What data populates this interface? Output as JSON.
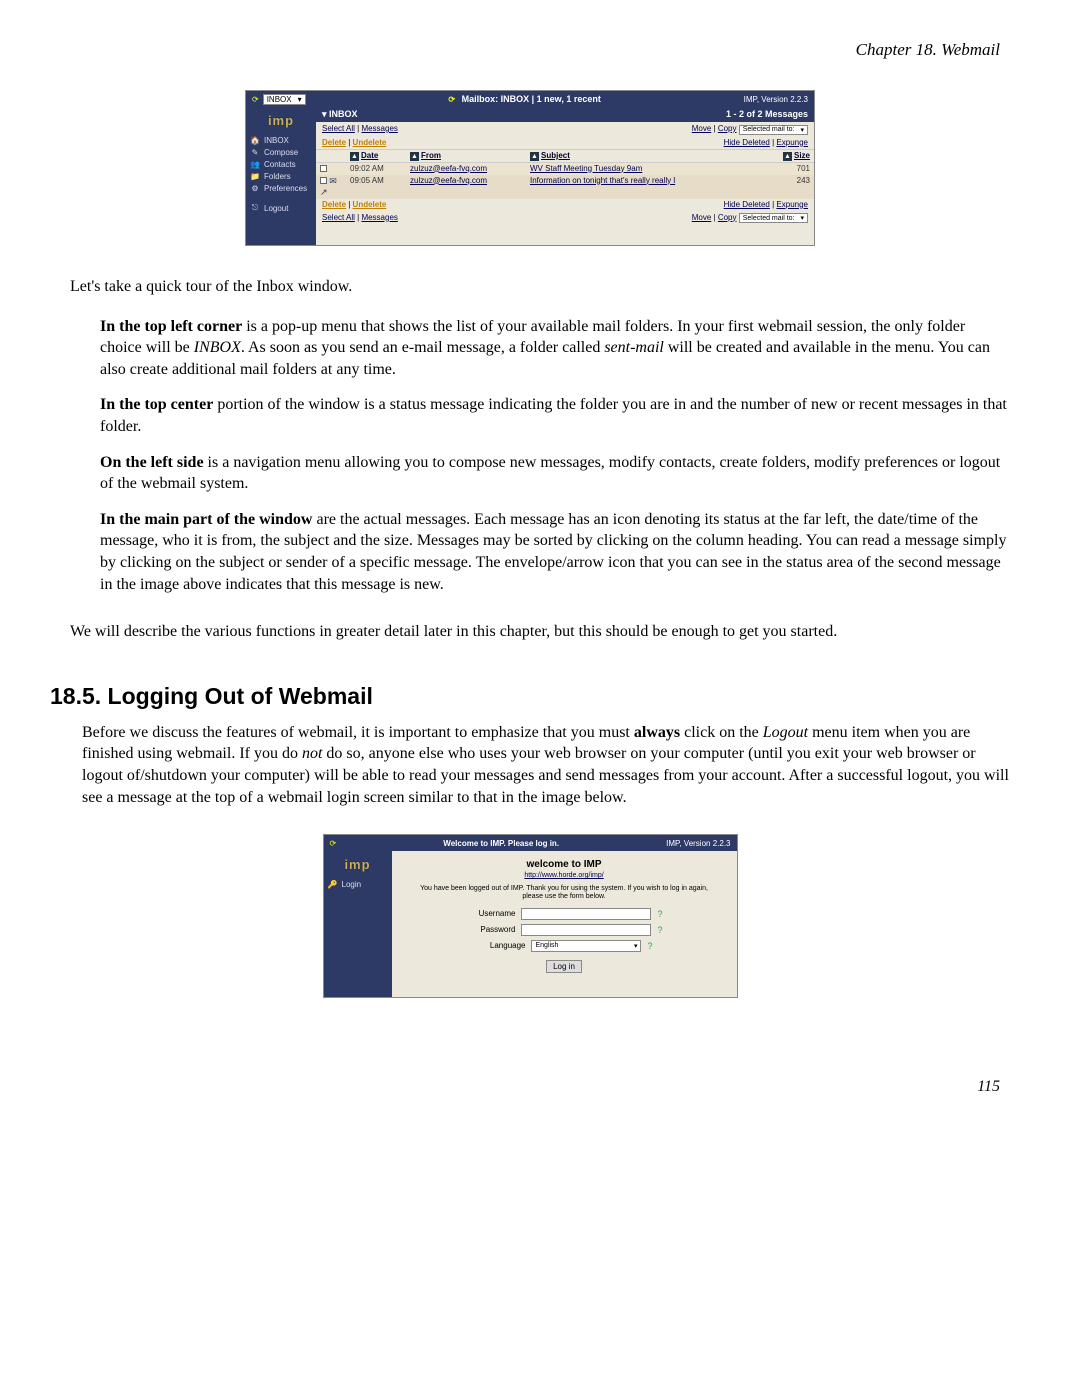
{
  "page": {
    "chapter_header": "Chapter 18. Webmail",
    "page_number": "115"
  },
  "screenshot1": {
    "topbar": {
      "folder_selected": "INBOX",
      "dropdown_arrow": "▾",
      "refresh_icon": "⟳",
      "status": "Mailbox: INBOX | 1 new, 1 recent",
      "version": "IMP, Version 2.2.3"
    },
    "sidebar": {
      "logo": "imp",
      "items": [
        {
          "icon": "🏠",
          "label": "INBOX"
        },
        {
          "icon": "✎",
          "label": "Compose"
        },
        {
          "icon": "👥",
          "label": "Contacts"
        },
        {
          "icon": "📁",
          "label": "Folders"
        },
        {
          "icon": "⚙",
          "label": "Preferences"
        }
      ],
      "logout": {
        "icon": "⎋",
        "label": "Logout"
      }
    },
    "main": {
      "inbox_label": "INBOX",
      "count_label": "1 - 2 of 2 Messages",
      "actions_top": {
        "left": {
          "a": "Select All",
          "sep": " | ",
          "b": "Messages"
        },
        "right": {
          "a": "Move",
          "sep": " | ",
          "b": "Copy",
          "select_text": "Selected mail to:",
          "arrow": "▾"
        }
      },
      "actions_mid": {
        "left": {
          "a": "Delete",
          "sep": " | ",
          "b": "Undelete"
        },
        "right": {
          "a": "Hide Deleted",
          "sep": " | ",
          "b": "Expunge"
        }
      },
      "headers": {
        "date": "Date",
        "from": "From",
        "subject": "Subject",
        "size": "Size",
        "arrow": "▲"
      },
      "rows": [
        {
          "icon": "",
          "date": "09:02 AM",
          "from": "zulzuz@eefa-fvq.com",
          "subject": "WV Staff Meeting Tuesday 9am",
          "size": "701"
        },
        {
          "icon": "✉↗",
          "date": "09:05 AM",
          "from": "zulzuz@eefa-fvq.com",
          "subject": "Information on tonight that's really really l",
          "size": "243"
        }
      ],
      "actions_bot_left": {
        "a": "Delete",
        "sep": " | ",
        "b": "Undelete"
      },
      "actions_bot_right": {
        "a": "Hide Deleted",
        "sep": " | ",
        "b": "Expunge"
      },
      "actions_bot2_left": {
        "a": "Select All",
        "sep": " | ",
        "b": "Messages"
      },
      "actions_bot2_right": {
        "a": "Move",
        "sep": " | ",
        "b": "Copy",
        "select_text": "Selected mail to:",
        "arrow": "▾"
      }
    }
  },
  "doc": {
    "intro": "Let's take a quick tour of the Inbox window.",
    "p1_bold": "In the top left corner",
    "p1_rest_a": " is a pop-up menu that shows the list of your available mail folders. In your first webmail session, the only folder choice will be ",
    "p1_em": "INBOX",
    "p1_rest_b": ". As soon as you send an e-mail message, a folder called ",
    "p1_em2": "sent-mail",
    "p1_rest_c": " will be created and available in the menu. You can also create additional mail folders at any time.",
    "p2_bold": "In the top center",
    "p2_rest": " portion of the window is a status message indicating the folder you are in and the number of new or recent messages in that folder.",
    "p3_bold": "On the left side",
    "p3_rest": " is a navigation menu allowing you to compose new messages, modify contacts, create folders, modify preferences or logout of the webmail system.",
    "p4_bold": "In the main part of the window",
    "p4_rest": " are the actual messages. Each message has an icon denoting its status at the far left, the date/time of the message, who it is from, the subject and the size. Messages may be sorted by clicking on the column heading. You can read a message simply by clicking on the subject or sender of a specific message. The envelope/arrow icon that you can see in the status area of the second message in the image above indicates that this message is new.",
    "transition": "We will describe the various functions in greater detail later in this chapter, but this should be enough to get you started."
  },
  "section": {
    "heading": "18.5. Logging Out of Webmail",
    "p_a": "Before we discuss the features of webmail, it is important to emphasize that you must ",
    "p_bold1": "always",
    "p_b": " click on the ",
    "p_em1": "Logout",
    "p_c": " menu item when you are finished using webmail. If you do ",
    "p_em2": "not",
    "p_d": " do so, anyone else who uses your web browser on your computer (until you exit your web browser or logout of/shutdown your computer) will be able to read your messages and send messages from your account. After a successful logout, you will see a message at the top of a webmail login screen similar to that in the image below."
  },
  "screenshot2": {
    "topbar": {
      "refresh": "⟳",
      "center": "Welcome to IMP. Please log in.",
      "version": "IMP, Version 2.2.3"
    },
    "sidebar": {
      "logo": "imp",
      "login": {
        "icon": "🔑",
        "label": "Login"
      }
    },
    "main": {
      "welcome": "welcome to IMP",
      "sublink": "http://www.horde.org/imp/",
      "msg": "You have been logged out of IMP. Thank you for using the system. If you wish to log in again, please use the form below.",
      "username_label": "Username",
      "password_label": "Password",
      "language_label": "Language",
      "language_value": "English",
      "language_arrow": "▾",
      "help_icon": "?",
      "login_btn": "Log in"
    }
  }
}
